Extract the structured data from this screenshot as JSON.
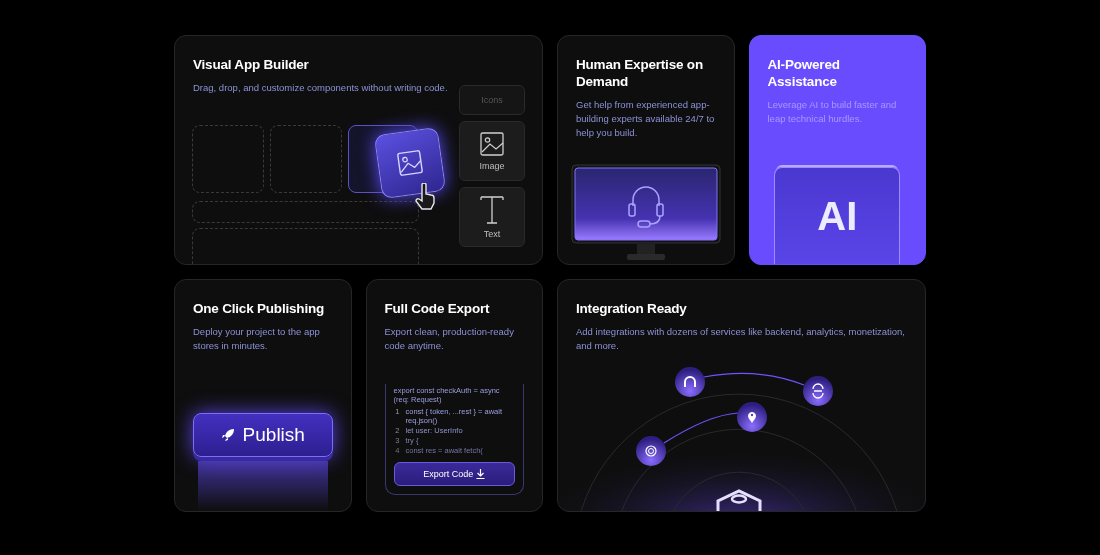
{
  "cards": [
    {
      "kind": "builder",
      "title": "Visual App Builder",
      "description": "Drag, drop, and customize components without writing code.",
      "palette": [
        {
          "kind": "icons",
          "label": "Icons"
        },
        {
          "kind": "image",
          "label": "Image"
        },
        {
          "kind": "text",
          "label": "Text"
        }
      ]
    },
    {
      "kind": "support",
      "title": "Human Expertise on Demand",
      "description": "Get help from experienced app-building experts available 24/7 to help you build."
    },
    {
      "kind": "ai",
      "title": "AI-Powered Assistance",
      "description": "Leverage AI to build faster and leap technical hurdles.",
      "chip_label": "AI"
    },
    {
      "kind": "publish",
      "title": "One Click Publishing",
      "description": "Deploy your project to the app stores in minutes.",
      "button": "Publish"
    },
    {
      "kind": "export",
      "title": "Full Code Export",
      "description": "Export clean, production-ready code anytime.",
      "code_header": "export const checkAuth = async (req: Request)",
      "code_lines": [
        {
          "number": "1",
          "code": "const { token, ...rest } = await req.json()"
        },
        {
          "number": "2",
          "code": "let user: UserInfo"
        },
        {
          "number": "3",
          "code": "try {"
        },
        {
          "number": "4",
          "code": "const res = await fetch("
        }
      ],
      "button": "Export Code"
    },
    {
      "kind": "integrations",
      "title": "Integration Ready",
      "description": "Add integrations with dozens of services like backend, analytics, monetization, and more."
    }
  ]
}
